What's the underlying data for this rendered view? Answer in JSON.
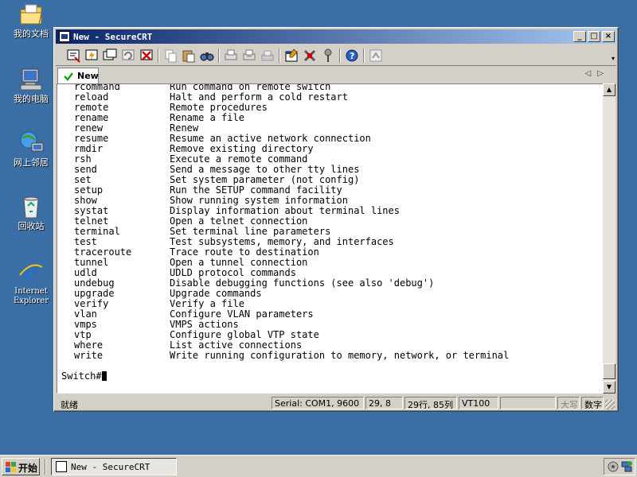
{
  "desktop": {
    "icons": [
      {
        "label": "我的文档"
      },
      {
        "label": "我的电脑"
      },
      {
        "label": "网上邻居"
      },
      {
        "label": "回收站"
      },
      {
        "label": "Internet Explorer"
      }
    ]
  },
  "window": {
    "title": "New - SecureCRT",
    "buttons": {
      "minimize": "_",
      "maximize": "□",
      "close": "×"
    }
  },
  "tabs": [
    {
      "label": "New"
    }
  ],
  "terminal": {
    "rows": [
      {
        "cmd": "rcommand",
        "desc": "Run command on remote switch"
      },
      {
        "cmd": "reload",
        "desc": "Halt and perform a cold restart"
      },
      {
        "cmd": "remote",
        "desc": "Remote procedures"
      },
      {
        "cmd": "rename",
        "desc": "Rename a file"
      },
      {
        "cmd": "renew",
        "desc": "Renew"
      },
      {
        "cmd": "resume",
        "desc": "Resume an active network connection"
      },
      {
        "cmd": "rmdir",
        "desc": "Remove existing directory"
      },
      {
        "cmd": "rsh",
        "desc": "Execute a remote command"
      },
      {
        "cmd": "send",
        "desc": "Send a message to other tty lines"
      },
      {
        "cmd": "set",
        "desc": "Set system parameter (not config)"
      },
      {
        "cmd": "setup",
        "desc": "Run the SETUP command facility"
      },
      {
        "cmd": "show",
        "desc": "Show running system information"
      },
      {
        "cmd": "systat",
        "desc": "Display information about terminal lines"
      },
      {
        "cmd": "telnet",
        "desc": "Open a telnet connection"
      },
      {
        "cmd": "terminal",
        "desc": "Set terminal line parameters"
      },
      {
        "cmd": "test",
        "desc": "Test subsystems, memory, and interfaces"
      },
      {
        "cmd": "traceroute",
        "desc": "Trace route to destination"
      },
      {
        "cmd": "tunnel",
        "desc": "Open a tunnel connection"
      },
      {
        "cmd": "udld",
        "desc": "UDLD protocol commands"
      },
      {
        "cmd": "undebug",
        "desc": "Disable debugging functions (see also 'debug')"
      },
      {
        "cmd": "upgrade",
        "desc": "Upgrade commands"
      },
      {
        "cmd": "verify",
        "desc": "Verify a file"
      },
      {
        "cmd": "vlan",
        "desc": "Configure VLAN parameters"
      },
      {
        "cmd": "vmps",
        "desc": "VMPS actions"
      },
      {
        "cmd": "vtp",
        "desc": "Configure global VTP state"
      },
      {
        "cmd": "where",
        "desc": "List active connections"
      },
      {
        "cmd": "write",
        "desc": "Write running configuration to memory, network, or terminal"
      }
    ],
    "prompt": "Switch#"
  },
  "status": {
    "ready": "就绪",
    "serial": "Serial: COM1, 9600",
    "cursor_pos": "29,  8",
    "rows_cols": "29行, 85列",
    "emulation": "VT100",
    "blank": "",
    "caps": "大写",
    "num": "数字"
  },
  "taskbar": {
    "start": "开始",
    "task": "New - SecureCRT"
  },
  "colors": {
    "desktop": "#3a6ea5",
    "titlebar": "#0a246a",
    "chrome": "#d4d0c8"
  }
}
